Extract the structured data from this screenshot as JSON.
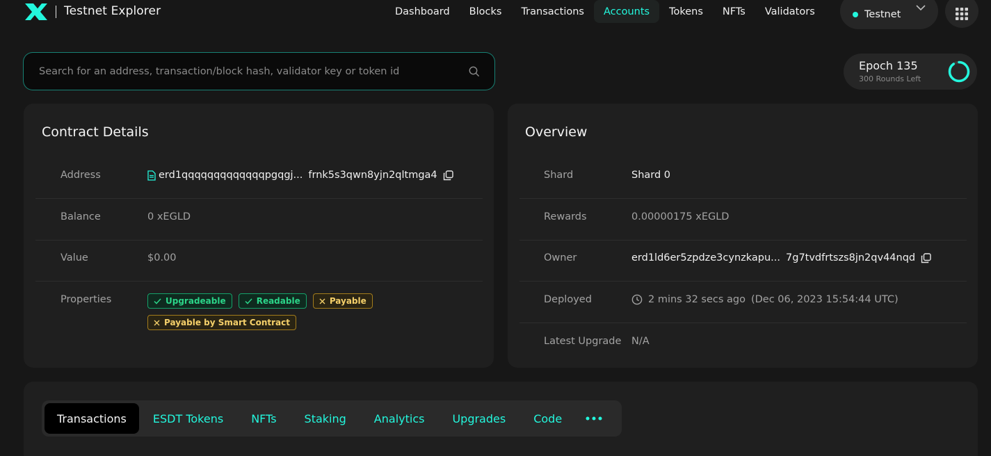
{
  "header": {
    "brand_title": "Testnet Explorer",
    "nav": [
      {
        "label": "Dashboard",
        "active": false
      },
      {
        "label": "Blocks",
        "active": false
      },
      {
        "label": "Transactions",
        "active": false
      },
      {
        "label": "Accounts",
        "active": true
      },
      {
        "label": "Tokens",
        "active": false
      },
      {
        "label": "NFTs",
        "active": false
      },
      {
        "label": "Validators",
        "active": false
      }
    ],
    "network_label": "Testnet",
    "icons": {
      "logo": "multiversx-logo",
      "network_chevron": "chevron-down-icon",
      "apps": "grid-icon"
    }
  },
  "search": {
    "placeholder": "Search for an address, transaction/block hash, validator key or token id",
    "value": ""
  },
  "epoch": {
    "title": "Epoch 135",
    "subtitle": "300 Rounds Left",
    "progress": 0.9
  },
  "contract_details": {
    "title": "Contract Details",
    "address": {
      "label": "Address",
      "start": "erd1qqqqqqqqqqqqqpgqgj...",
      "end": "frnk5s3qwn8yjn2qltmga4"
    },
    "balance": {
      "label": "Balance",
      "value": "0 xEGLD"
    },
    "value": {
      "label": "Value",
      "value": "$0.00"
    },
    "properties": {
      "label": "Properties",
      "badges": [
        {
          "label": "Upgradeable",
          "enabled": true
        },
        {
          "label": "Readable",
          "enabled": true
        },
        {
          "label": "Payable",
          "enabled": false
        },
        {
          "label": "Payable by Smart Contract",
          "enabled": false
        }
      ]
    }
  },
  "overview": {
    "title": "Overview",
    "shard": {
      "label": "Shard",
      "value": "Shard 0"
    },
    "rewards": {
      "label": "Rewards",
      "value": "0.00000175 xEGLD"
    },
    "owner": {
      "label": "Owner",
      "start": "erd1ld6er5zpdze3cynzkapu...",
      "end": "7g7tvdfrtszs8jn2qv44nqd"
    },
    "deployed": {
      "label": "Deployed",
      "ago": "2 mins 32 secs ago",
      "date": "(Dec 06, 2023 15:54:44 UTC)"
    },
    "latest_upgrade": {
      "label": "Latest Upgrade",
      "value": "N/A"
    }
  },
  "tabs": [
    {
      "label": "Transactions",
      "active": true
    },
    {
      "label": "ESDT Tokens",
      "active": false
    },
    {
      "label": "NFTs",
      "active": false
    },
    {
      "label": "Staking",
      "active": false
    },
    {
      "label": "Analytics",
      "active": false
    },
    {
      "label": "Upgrades",
      "active": false
    },
    {
      "label": "Code",
      "active": false
    }
  ],
  "colors": {
    "accent": "#23f7dd",
    "background": "#171717",
    "card": "#1f1f1f",
    "success": "#2bd589",
    "warning": "#f5d06a"
  }
}
